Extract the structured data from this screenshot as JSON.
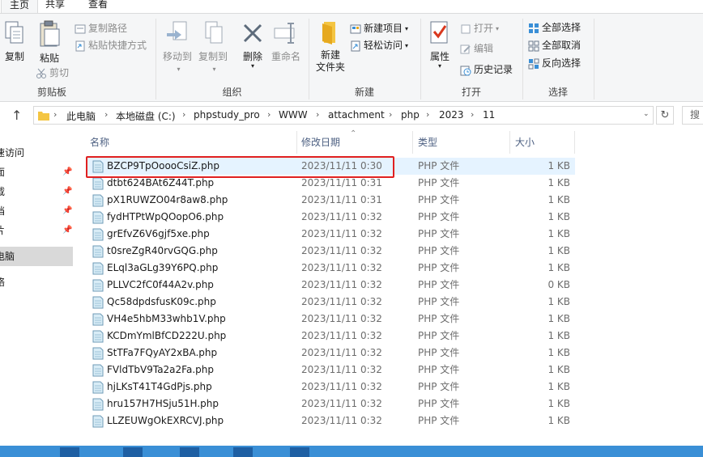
{
  "tabs": [
    "主页",
    "共享",
    "查看"
  ],
  "ribbon": {
    "clipboard": {
      "title": "剪贴板",
      "copy": "复制",
      "paste": "粘贴",
      "copy_path": "复制路径",
      "paste_shortcut": "粘贴快捷方式",
      "cut": "剪切"
    },
    "organize": {
      "title": "组织",
      "move_to": "移动到",
      "copy_to": "复制到",
      "delete": "删除",
      "rename": "重命名"
    },
    "new": {
      "title": "新建",
      "new_folder": "新建\n文件夹",
      "new_item": "新建项目",
      "easy_access": "轻松访问"
    },
    "open": {
      "title": "打开",
      "properties": "属性",
      "open": "打开",
      "edit": "编辑",
      "history": "历史记录"
    },
    "select": {
      "title": "选择",
      "select_all": "全部选择",
      "select_none": "全部取消",
      "invert": "反向选择"
    }
  },
  "address": {
    "crumbs": [
      "此电脑",
      "本地磁盘 (C:)",
      "phpstudy_pro",
      "WWW",
      "attachment",
      "php",
      "2023",
      "11"
    ],
    "search_placeholder": "搜"
  },
  "nav": {
    "items": [
      {
        "label": "速访问",
        "pinned": false,
        "selected": false
      },
      {
        "label": "面",
        "pinned": true,
        "selected": false
      },
      {
        "label": "载",
        "pinned": true,
        "selected": false
      },
      {
        "label": "档",
        "pinned": true,
        "selected": false
      },
      {
        "label": "片",
        "pinned": true,
        "selected": false
      },
      {
        "label": "电脑",
        "pinned": false,
        "selected": true
      },
      {
        "label": "络",
        "pinned": false,
        "selected": false
      }
    ]
  },
  "columns": {
    "name": "名称",
    "date": "修改日期",
    "type": "类型",
    "size": "大小"
  },
  "files": [
    {
      "name": "BZCP9TpOoooCsiZ.php",
      "date": "2023/11/11 0:30",
      "type": "PHP 文件",
      "size": "1 KB"
    },
    {
      "name": "dtbt624BAt6Z44T.php",
      "date": "2023/11/11 0:31",
      "type": "PHP 文件",
      "size": "1 KB"
    },
    {
      "name": "pX1RUWZO04r8aw8.php",
      "date": "2023/11/11 0:31",
      "type": "PHP 文件",
      "size": "1 KB"
    },
    {
      "name": "fydHTPtWpQOopO6.php",
      "date": "2023/11/11 0:32",
      "type": "PHP 文件",
      "size": "1 KB"
    },
    {
      "name": "grEfvZ6V6gjf5xe.php",
      "date": "2023/11/11 0:32",
      "type": "PHP 文件",
      "size": "1 KB"
    },
    {
      "name": "t0sreZgR40rvGQG.php",
      "date": "2023/11/11 0:32",
      "type": "PHP 文件",
      "size": "1 KB"
    },
    {
      "name": "ELql3aGLg39Y6PQ.php",
      "date": "2023/11/11 0:32",
      "type": "PHP 文件",
      "size": "1 KB"
    },
    {
      "name": "PLLVC2fC0f44A2v.php",
      "date": "2023/11/11 0:32",
      "type": "PHP 文件",
      "size": "0 KB"
    },
    {
      "name": "Qc58dpdsfusK09c.php",
      "date": "2023/11/11 0:32",
      "type": "PHP 文件",
      "size": "1 KB"
    },
    {
      "name": "VH4e5hbM33whb1V.php",
      "date": "2023/11/11 0:32",
      "type": "PHP 文件",
      "size": "1 KB"
    },
    {
      "name": "KCDmYmlBfCD222U.php",
      "date": "2023/11/11 0:32",
      "type": "PHP 文件",
      "size": "1 KB"
    },
    {
      "name": "StTFa7FQyAY2xBA.php",
      "date": "2023/11/11 0:32",
      "type": "PHP 文件",
      "size": "1 KB"
    },
    {
      "name": "FVldTbV9Ta2a2Fa.php",
      "date": "2023/11/11 0:32",
      "type": "PHP 文件",
      "size": "1 KB"
    },
    {
      "name": "hjLKsT41T4GdPjs.php",
      "date": "2023/11/11 0:32",
      "type": "PHP 文件",
      "size": "1 KB"
    },
    {
      "name": "hru157H7HSju51H.php",
      "date": "2023/11/11 0:32",
      "type": "PHP 文件",
      "size": "1 KB"
    },
    {
      "name": "LLZEUWgOkEXRCVJ.php",
      "date": "2023/11/11 0:32",
      "type": "PHP 文件",
      "size": "1 KB"
    }
  ],
  "colors": {
    "accent": "#3a8fd6",
    "highlight_box": "#e02020",
    "hover_row": "#e5f3ff",
    "header_text": "#4d6082"
  }
}
